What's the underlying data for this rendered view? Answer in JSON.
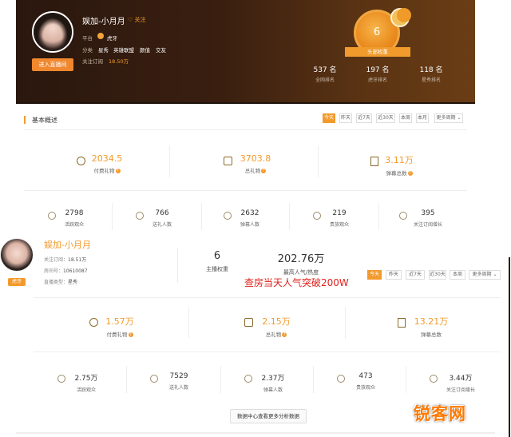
{
  "header": {
    "host_name": "娱加-小月月",
    "follow_label": "关注",
    "platform_label": "平台",
    "platform_value": "虎牙",
    "category_label": "分类",
    "categories": [
      "星秀",
      "英雄联盟",
      "颜值",
      "交友"
    ],
    "subs_label": "关注订阅",
    "subs_value": "18.50万",
    "enter_button": "进入直播间",
    "medal_number": "6",
    "medal_ribbon": "头部权重",
    "ranks": [
      {
        "value": "537 名",
        "label": "全网排名"
      },
      {
        "value": "197 名",
        "label": "虎牙排名"
      },
      {
        "value": "118 名",
        "label": "星秀排名"
      }
    ]
  },
  "overview": {
    "title": "基本概述",
    "tabs": [
      "今天",
      "昨天",
      "近7天",
      "近30天",
      "本周",
      "本月",
      "更多周期 ⌄"
    ],
    "active_tab": 0,
    "big_stats": [
      {
        "value": "2034.5",
        "label": "付费礼物",
        "icon": "coin-icon"
      },
      {
        "value": "3703.8",
        "label": "总礼物",
        "icon": "gift-icon"
      },
      {
        "value": "3.11万",
        "label": "弹幕总数",
        "icon": "danmaku-icon"
      }
    ],
    "small_stats": [
      {
        "value": "2798",
        "label": "活跃观众"
      },
      {
        "value": "766",
        "label": "送礼人数"
      },
      {
        "value": "2632",
        "label": "弹幕人数"
      },
      {
        "value": "219",
        "label": "贵族观众"
      },
      {
        "value": "395",
        "label": "关注订阅增长"
      }
    ]
  },
  "overlay": {
    "badge": "虎牙",
    "name": "娱加-小月月",
    "info": [
      {
        "label": "关注订阅：",
        "value": "18.51万"
      },
      {
        "label": "房间号：",
        "value": "10610087"
      },
      {
        "label": "直播类型：",
        "value": "星秀"
      }
    ],
    "weight_value": "6",
    "weight_label": "主播权重",
    "peak_value": "202.76万",
    "peak_label": "最高人气/热度",
    "note": "查房当天人气突破200W",
    "tabs": [
      "今天",
      "昨天",
      "近7天",
      "近30天",
      "本周",
      "本月",
      "更多周期 ⌄"
    ],
    "active_tab": 0
  },
  "overview2": {
    "big_stats": [
      {
        "value": "1.57万",
        "label": "付费礼物",
        "icon": "coin-icon"
      },
      {
        "value": "2.15万",
        "label": "总礼物",
        "icon": "gift-icon"
      },
      {
        "value": "13.21万",
        "label": "弹幕总数",
        "icon": "danmaku-icon"
      }
    ],
    "small_stats": [
      {
        "value": "2.75万",
        "label": "活跃观众"
      },
      {
        "value": "7529",
        "label": "送礼人数"
      },
      {
        "value": "2.37万",
        "label": "弹幕人数"
      },
      {
        "value": "473",
        "label": "贵族观众"
      },
      {
        "value": "3.44万",
        "label": "关注订阅增长"
      }
    ],
    "data_center_button": "数据中心查看更多分析数据"
  },
  "watermark": "锐客网",
  "colors": {
    "accent": "#f39a2c",
    "hero_dark": "#2a170e",
    "note_red": "#e0221d"
  }
}
